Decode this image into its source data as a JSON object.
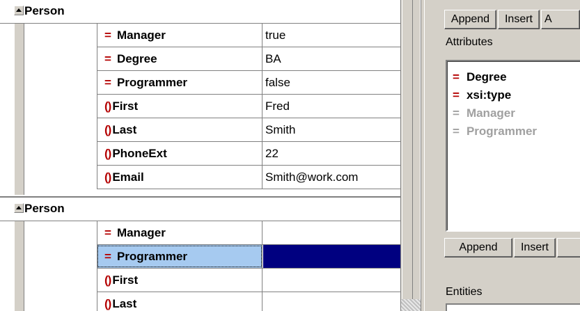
{
  "grid": {
    "groups": [
      {
        "label": "Person",
        "rows": [
          {
            "type": "attribute",
            "icon": "=",
            "name": "Manager",
            "value": "true"
          },
          {
            "type": "attribute",
            "icon": "=",
            "name": "Degree",
            "value": "BA"
          },
          {
            "type": "attribute",
            "icon": "=",
            "name": "Programmer",
            "value": "false"
          },
          {
            "type": "element",
            "icon": "()",
            "name": "First",
            "value": "Fred"
          },
          {
            "type": "element",
            "icon": "()",
            "name": "Last",
            "value": "Smith"
          },
          {
            "type": "element",
            "icon": "()",
            "name": "PhoneExt",
            "value": "22"
          },
          {
            "type": "element",
            "icon": "()",
            "name": "Email",
            "value": "Smith@work.com"
          }
        ]
      },
      {
        "label": "Person",
        "rows": [
          {
            "type": "attribute",
            "icon": "=",
            "name": "Manager",
            "value": ""
          },
          {
            "type": "attribute",
            "icon": "=",
            "name": "Programmer",
            "value": "",
            "selected": true
          },
          {
            "type": "element",
            "icon": "()",
            "name": "First",
            "value": ""
          },
          {
            "type": "element",
            "icon": "()",
            "name": "Last",
            "value": ""
          }
        ]
      }
    ]
  },
  "attributes_panel": {
    "tabs": [
      "Append",
      "Insert",
      "A"
    ],
    "title": "Attributes",
    "items": [
      {
        "name": "Degree",
        "state": "used"
      },
      {
        "name": "xsi:type",
        "state": "used"
      },
      {
        "name": "Manager",
        "state": "unused"
      },
      {
        "name": "Programmer",
        "state": "unused"
      }
    ],
    "bottom_tabs": [
      "Append",
      "Insert",
      ""
    ]
  },
  "entities_panel": {
    "title": "Entities"
  },
  "colors": {
    "icon_red": "#b40000",
    "selection_navy": "#000080",
    "selection_light": "#a6caf0",
    "panel_gray": "#d4d0c8"
  }
}
